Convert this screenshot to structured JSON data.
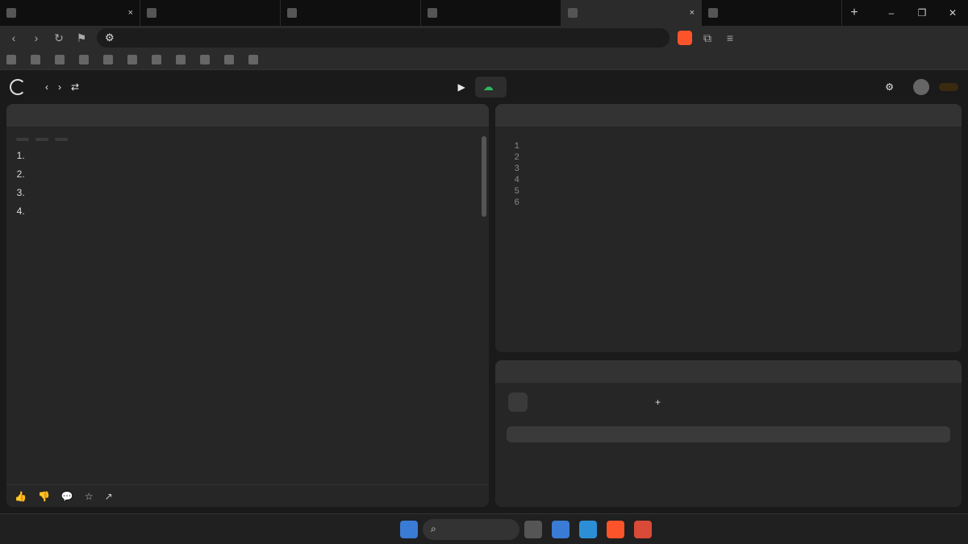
{
  "browser": {
    "tabs": [
      {
        "label": ""
      },
      {
        "label": ""
      },
      {
        "label": ""
      },
      {
        "label": ""
      },
      {
        "label": ""
      },
      {
        "label": ""
      }
    ],
    "url": "",
    "bookmarks": [
      "",
      "",
      "",
      "",
      "",
      "",
      "",
      "",
      "",
      "",
      ""
    ]
  },
  "header": {
    "problem_list": "",
    "submit": "",
    "premium": "",
    "counter": ""
  },
  "description": {
    "tabs": [
      "",
      "",
      "",
      ""
    ],
    "title": "",
    "status": "",
    "difficulty": "",
    "topics": "",
    "companies": "",
    "summary_block": "",
    "rules": [
      "",
      "",
      "",
      ""
    ],
    "closing": "",
    "example_heading": "",
    "example_input": "",
    "example_output": "",
    "likes": "",
    "comments": "",
    "online": ""
  },
  "editor": {
    "tab": "",
    "language": "",
    "mode": "",
    "saved": "",
    "cursor": "",
    "lines": [
      "",
      "",
      "",
      "",
      "",
      ""
    ]
  },
  "testcase": {
    "tab": "",
    "result_tab": "",
    "cases": [
      "",
      "",
      "",
      "",
      ""
    ],
    "param": "",
    "value": "",
    "source": ""
  },
  "taskbar": {
    "temp": "",
    "weather": "",
    "search": "",
    "lang": "",
    "region": "",
    "time": "",
    "date": ""
  }
}
